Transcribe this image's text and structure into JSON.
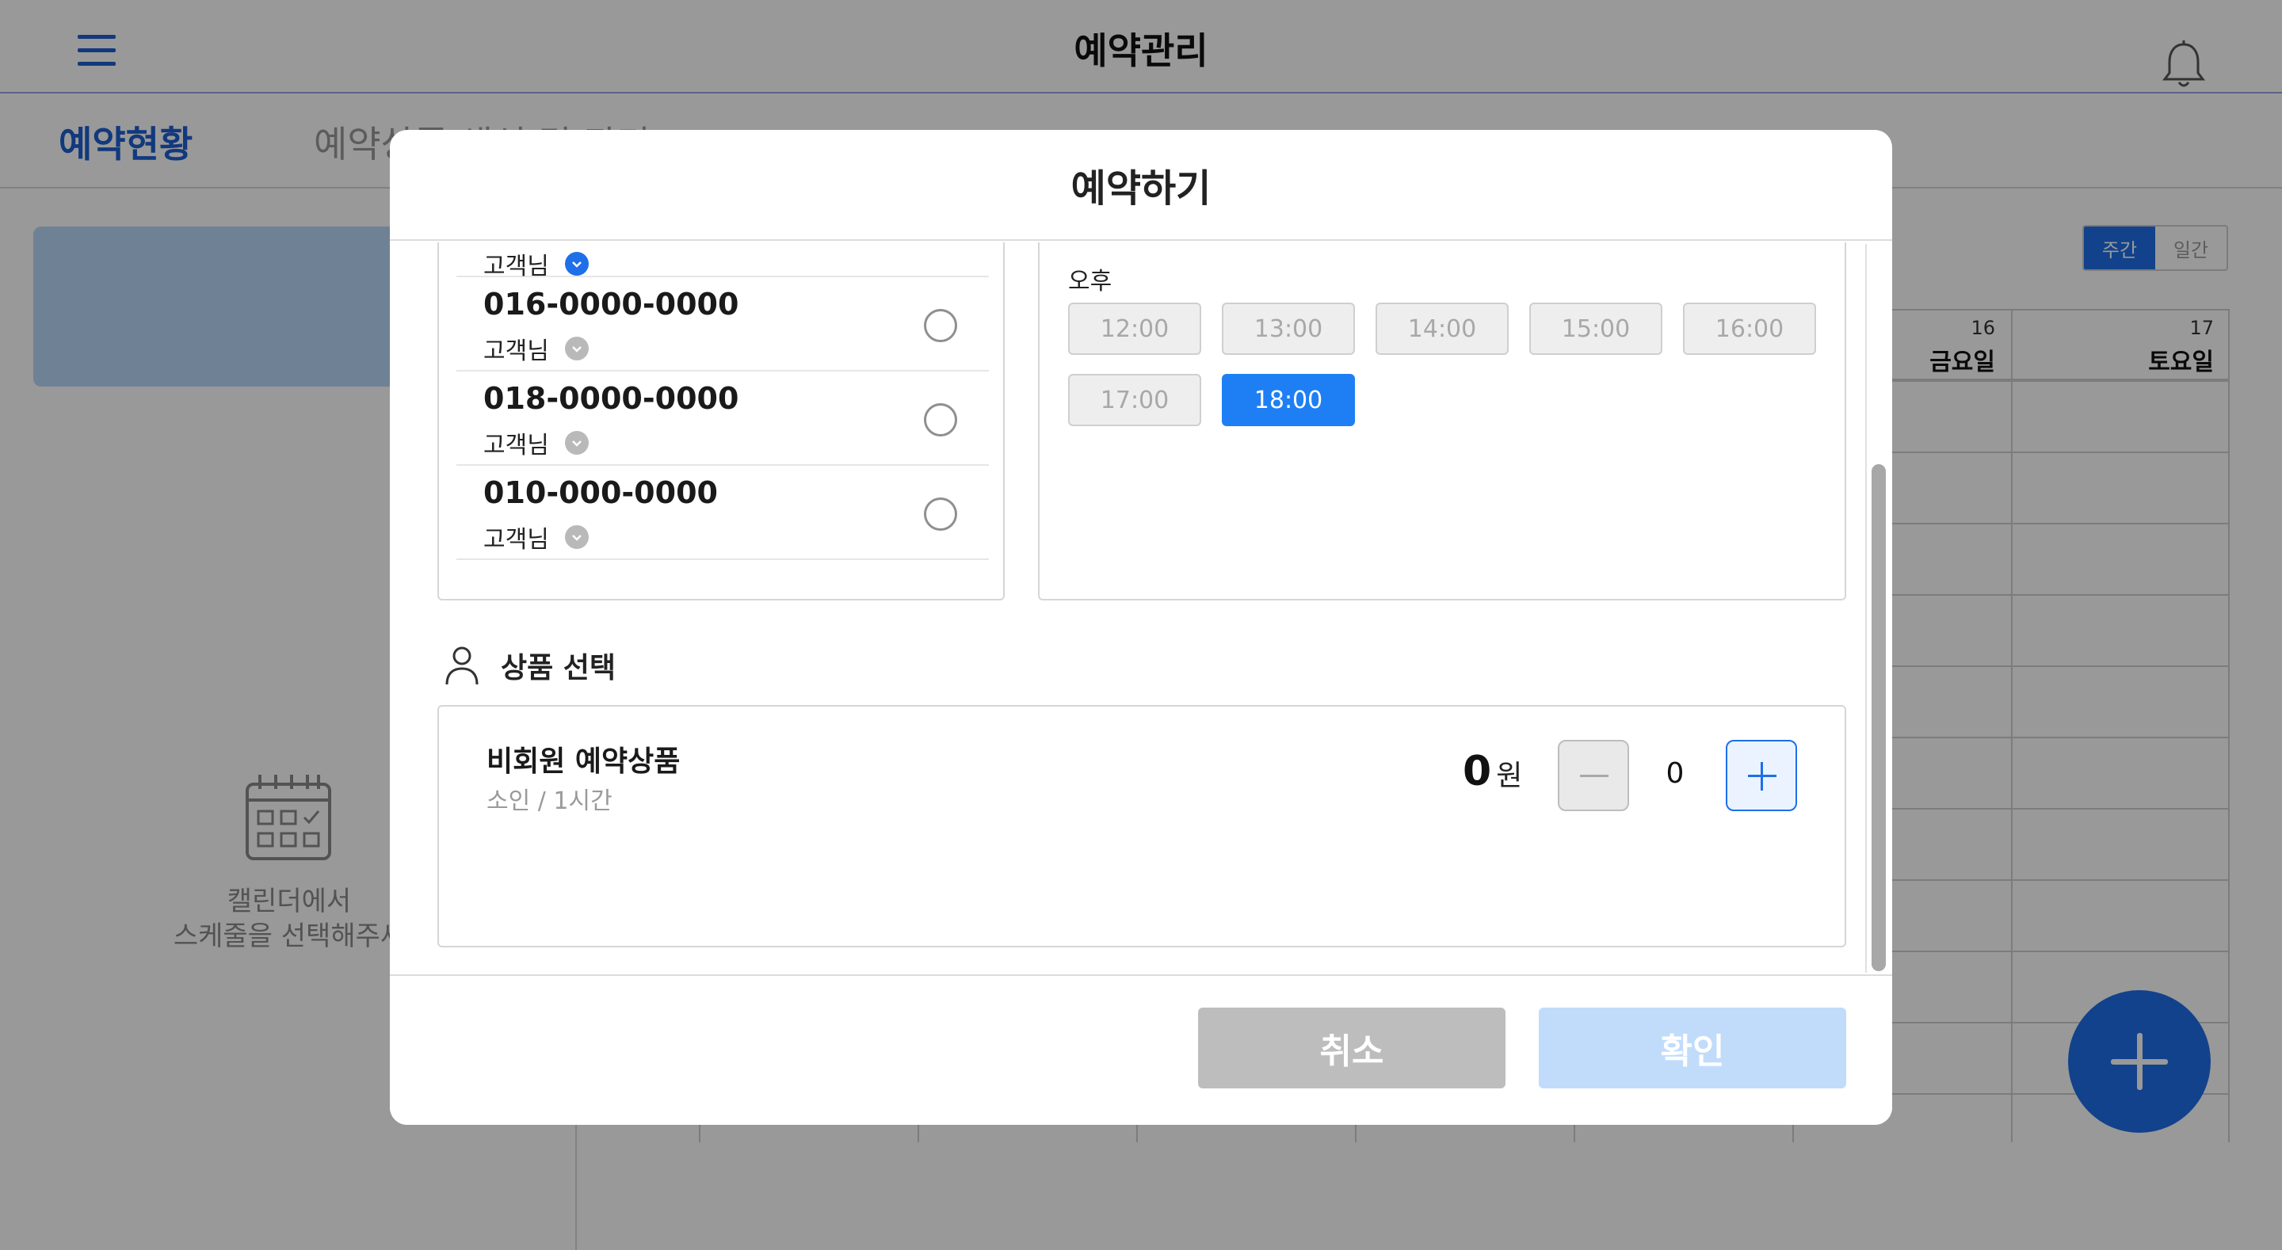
{
  "app": {
    "title": "예약관리",
    "tabs": [
      {
        "label": "예약현황",
        "active": true
      },
      {
        "label": "예약상품 생성 및 관리",
        "active": false
      }
    ],
    "empty_message_line1": "캘린더에서",
    "empty_message_line2": "스케줄을 선택해주세",
    "view_toggle": {
      "week": "주간",
      "day": "일간",
      "selected": "주간"
    },
    "calendar": {
      "days": [
        {
          "num": "16",
          "name": "금요일"
        },
        {
          "num": "17",
          "name": "토요일"
        }
      ]
    }
  },
  "modal": {
    "title": "예약하기",
    "customers": [
      {
        "phone": "",
        "name": "고객님",
        "badge": "blue",
        "selected": false
      },
      {
        "phone": "016-0000-0000",
        "name": "고객님",
        "badge": "gray",
        "selected": false
      },
      {
        "phone": "018-0000-0000",
        "name": "고객님",
        "badge": "gray",
        "selected": false
      },
      {
        "phone": "010-000-0000",
        "name": "고객님",
        "badge": "gray",
        "selected": false
      }
    ],
    "time": {
      "period_label": "오후",
      "slots": [
        {
          "label": "12:00",
          "selected": false
        },
        {
          "label": "13:00",
          "selected": false
        },
        {
          "label": "14:00",
          "selected": false
        },
        {
          "label": "15:00",
          "selected": false
        },
        {
          "label": "16:00",
          "selected": false
        },
        {
          "label": "17:00",
          "selected": false
        },
        {
          "label": "18:00",
          "selected": true
        }
      ]
    },
    "product_section_title": "상품 선택",
    "product": {
      "name": "비회원 예약상품",
      "sub": "소인 / 1시간",
      "price": "0",
      "price_unit": "원",
      "quantity": "0"
    },
    "buttons": {
      "cancel": "취소",
      "confirm": "확인"
    }
  },
  "colors": {
    "accent": "#1e6fe8",
    "selected_slot": "#1e7ff5",
    "confirm_disabled": "#c1dcfb",
    "cancel": "#bdbdbd"
  }
}
